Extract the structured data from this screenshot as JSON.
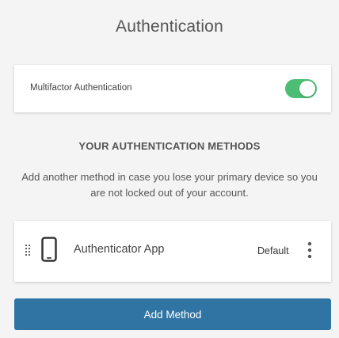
{
  "page": {
    "title": "Authentication"
  },
  "mfa": {
    "label": "Multifactor Authentication",
    "enabled": true,
    "toggle_color": "#4dbd74"
  },
  "methods_section": {
    "heading": "YOUR AUTHENTICATION METHODS",
    "description": "Add another method in case you lose your primary device so you are not locked out of your account."
  },
  "methods": [
    {
      "name": "Authenticator App",
      "icon": "phone-icon",
      "badge": "Default",
      "menu_icon": "more-vertical-icon"
    }
  ],
  "actions": {
    "add_method_label": "Add Method",
    "button_color": "#2f74a3"
  }
}
